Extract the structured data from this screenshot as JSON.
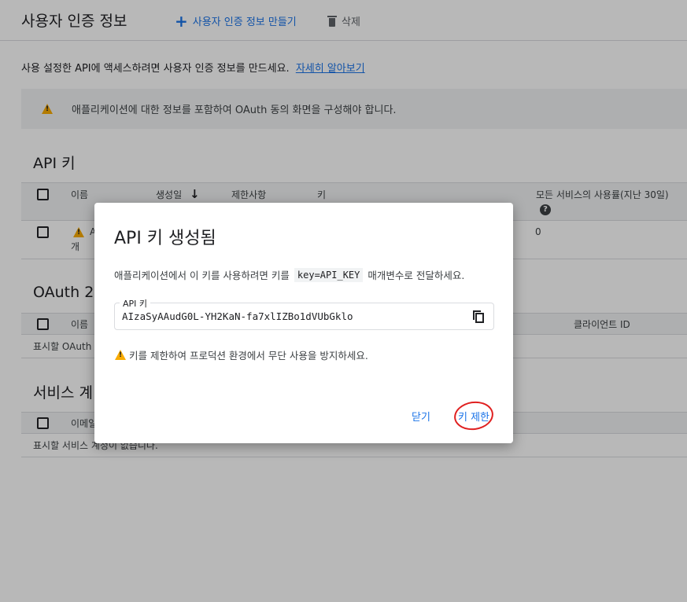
{
  "header": {
    "title": "사용자 인증 정보",
    "create_label": "사용자 인증 정보 만들기",
    "delete_label": "삭제"
  },
  "intro": {
    "text": "사용 설정한 API에 액세스하려면 사용자 인증 정보를 만드세요.",
    "link": "자세히 알아보기"
  },
  "banner": {
    "text": "애플리케이션에 대한 정보를 포함하여 OAuth 동의 화면을 구성해야 합니다."
  },
  "api_keys": {
    "title": "API 키",
    "columns": [
      "이름",
      "생성일",
      "제한사항",
      "키",
      "모든 서비스의 사용률(지난 30일)"
    ],
    "row": {
      "name_visible": "A",
      "name_wrap": "개",
      "usage": "0"
    }
  },
  "oauth": {
    "title_visible": "OAuth 2.",
    "columns": [
      "이름",
      "클라이언트 ID"
    ],
    "empty_visible": "표시할 OAuth"
  },
  "service": {
    "title_visible": "서비스 계",
    "columns": [
      "이메일"
    ],
    "empty_visible": "표시할 서비스 계정이 없습니다."
  },
  "dialog": {
    "title": "API 키 생성됨",
    "desc_before": "애플리케이션에서 이 키를 사용하려면 키를",
    "desc_code": "key=API_KEY",
    "desc_after": "매개변수로 전달하세요.",
    "field_label": "API 키",
    "api_key": "AIzaSyAAudG0L-YH2KaN-fa7xlIZBo1dVUbGklo",
    "warning": "키를 제한하여 프로덕션 환경에서 무단 사용을 방지하세요.",
    "close_label": "닫기",
    "restrict_label": "키 제한"
  },
  "colors": {
    "accent": "#1a73e8",
    "warning": "#f9ab00",
    "annotation": "#e02020"
  }
}
